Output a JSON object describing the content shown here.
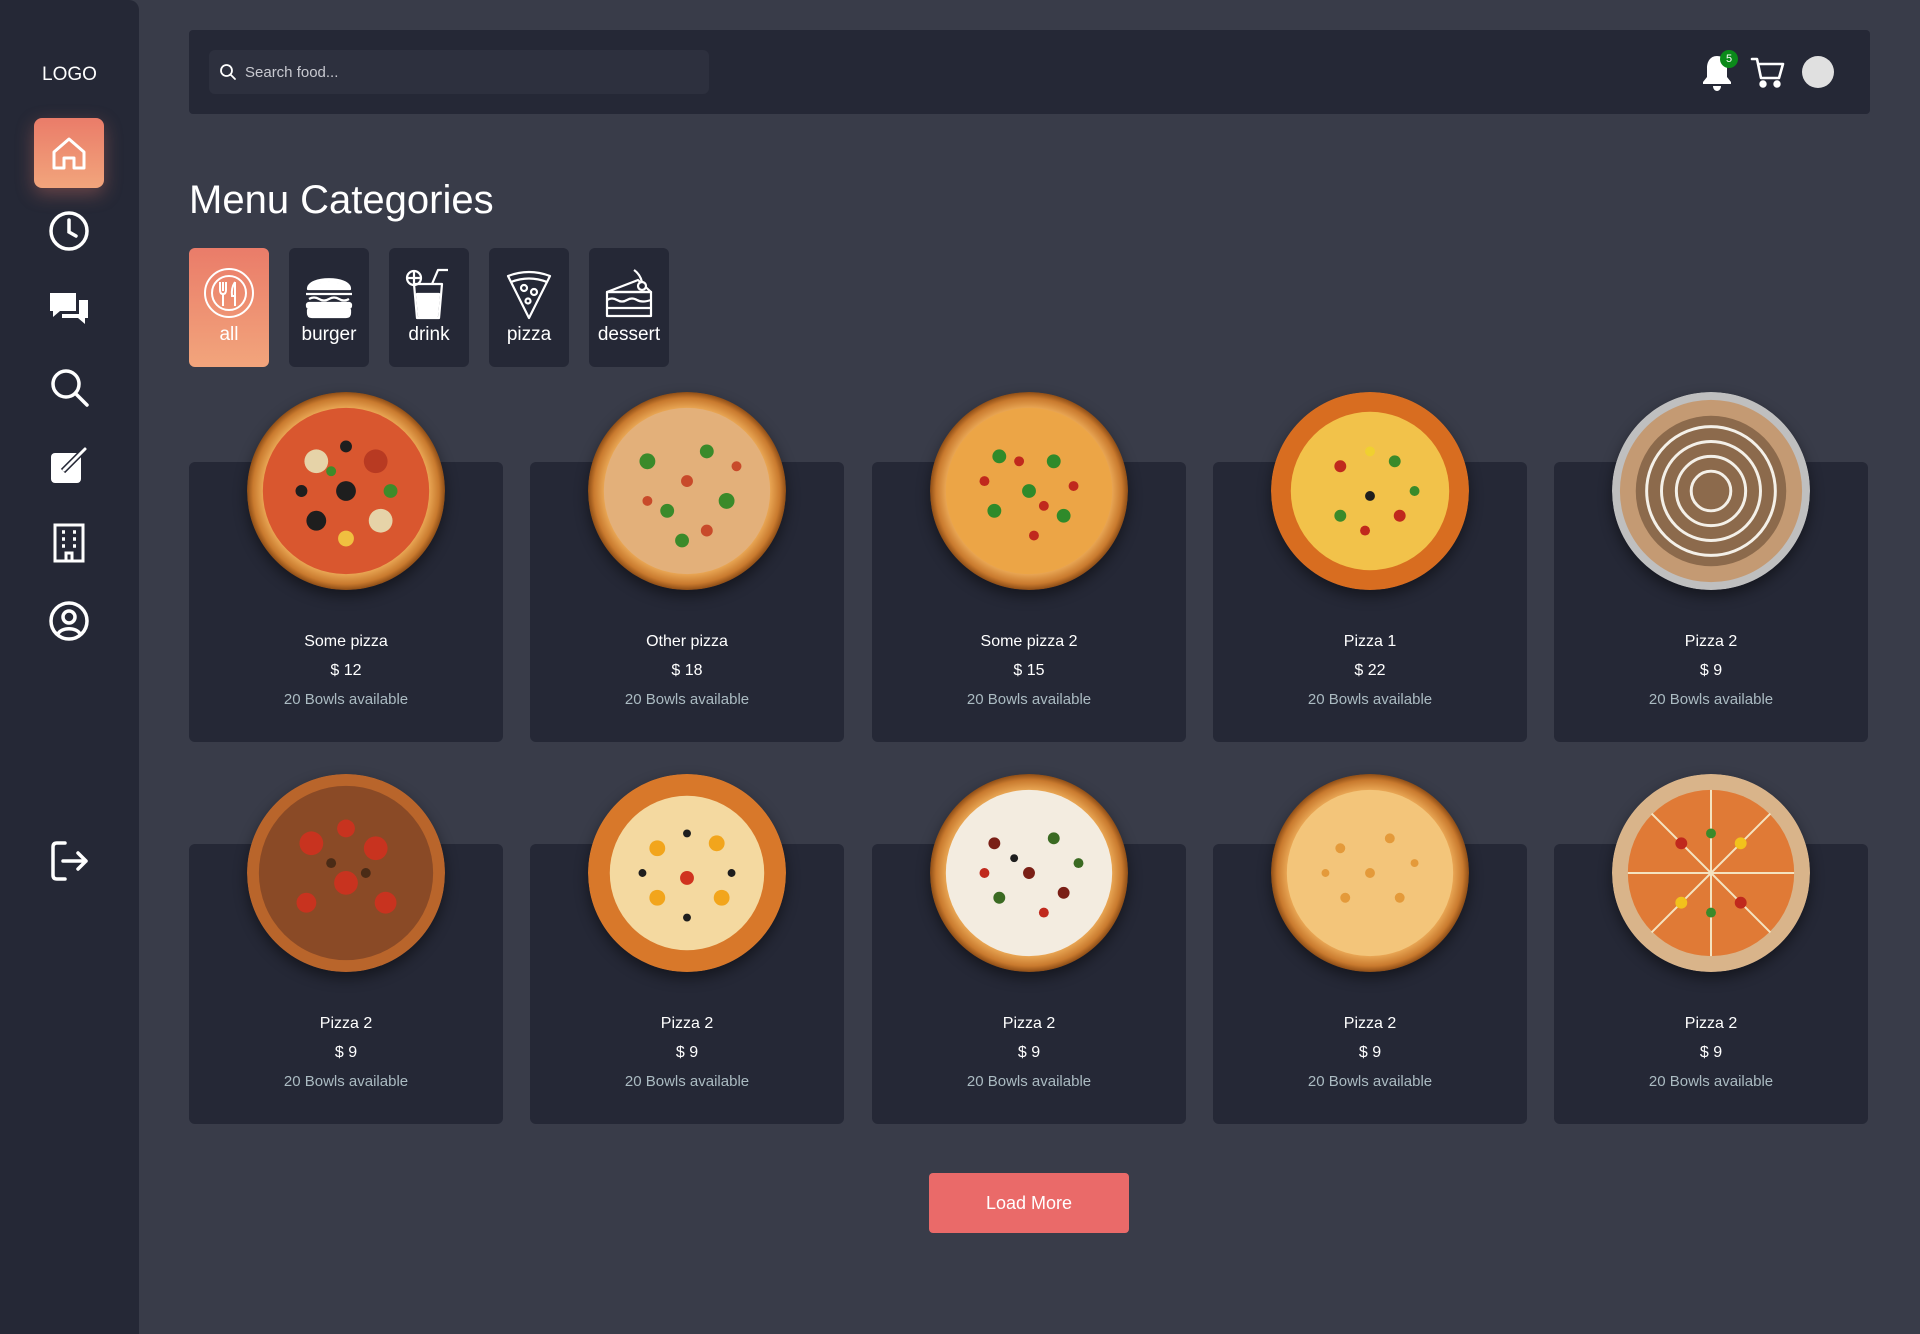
{
  "sidebar": {
    "logo": "LOGO",
    "items": [
      {
        "icon": "home-icon",
        "active": true
      },
      {
        "icon": "clock-icon",
        "active": false
      },
      {
        "icon": "chat-icon",
        "active": false
      },
      {
        "icon": "search-icon",
        "active": false
      },
      {
        "icon": "edit-icon",
        "active": false
      },
      {
        "icon": "building-icon",
        "active": false
      },
      {
        "icon": "user-circle-icon",
        "active": false
      }
    ],
    "logout_icon": "logout-icon"
  },
  "topbar": {
    "search_placeholder": "Search food...",
    "notification_count": "5",
    "cart_icon": "cart-icon",
    "avatar": "avatar"
  },
  "main": {
    "title": "Menu Categories",
    "categories": [
      {
        "label": "all",
        "icon": "plate-icon",
        "active": true
      },
      {
        "label": "burger",
        "icon": "burger-icon",
        "active": false
      },
      {
        "label": "drink",
        "icon": "drink-icon",
        "active": false
      },
      {
        "label": "pizza",
        "icon": "pizza-slice-icon",
        "active": false
      },
      {
        "label": "dessert",
        "icon": "cake-icon",
        "active": false
      }
    ],
    "items": [
      {
        "name": "Some pizza",
        "price": "$ 12",
        "availability": "20 Bowls available"
      },
      {
        "name": "Other pizza",
        "price": "$ 18",
        "availability": "20 Bowls available"
      },
      {
        "name": "Some pizza 2",
        "price": "$ 15",
        "availability": "20 Bowls available"
      },
      {
        "name": "Pizza 1",
        "price": "$ 22",
        "availability": "20 Bowls available"
      },
      {
        "name": "Pizza 2",
        "price": "$ 9",
        "availability": "20 Bowls available"
      },
      {
        "name": "Pizza 2",
        "price": "$ 9",
        "availability": "20 Bowls available"
      },
      {
        "name": "Pizza 2",
        "price": "$ 9",
        "availability": "20 Bowls available"
      },
      {
        "name": "Pizza 2",
        "price": "$ 9",
        "availability": "20 Bowls available"
      },
      {
        "name": "Pizza 2",
        "price": "$ 9",
        "availability": "20 Bowls available"
      },
      {
        "name": "Pizza 2",
        "price": "$ 9",
        "availability": "20 Bowls available"
      }
    ],
    "load_more_label": "Load More"
  },
  "colors": {
    "background": "#393c49",
    "panel": "#252836",
    "accent": "#ea7c69",
    "load_more": "#ea6a69",
    "muted_text": "#abbbc2",
    "badge": "#0b8a1a"
  }
}
